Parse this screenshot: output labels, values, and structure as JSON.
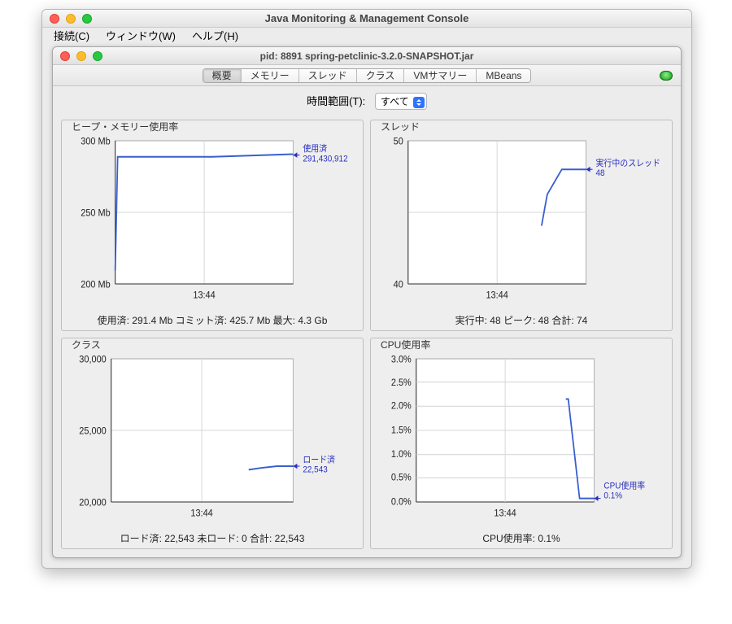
{
  "window": {
    "outer_title": "Java Monitoring & Management Console",
    "inner_title": "pid: 8891 spring-petclinic-3.2.0-SNAPSHOT.jar"
  },
  "menu": {
    "items": [
      "接続(C)",
      "ウィンドウ(W)",
      "ヘルプ(H)"
    ]
  },
  "tabs": {
    "items": [
      "概要",
      "メモリー",
      "スレッド",
      "クラス",
      "VMサマリー",
      "MBeans"
    ],
    "active_index": 0
  },
  "range": {
    "label": "時間範囲(T):",
    "value": "すべて"
  },
  "panels": {
    "heap": {
      "title": "ヒープ・メモリー使用率",
      "footer": "使用済: 291.4 Mb    コミット済: 425.7 Mb    最大: 4.3 Gb",
      "call_label": "使用済",
      "call_value": "291,430,912",
      "yticks": [
        "300 Mb",
        "250 Mb",
        "200 Mb"
      ],
      "xtick": "13:44"
    },
    "threads": {
      "title": "スレッド",
      "footer": "実行中: 48    ピーク: 48    合計: 74",
      "call_label": "実行中のスレッド",
      "call_value": "48",
      "yticks": [
        "50",
        "40"
      ],
      "xtick": "13:44"
    },
    "classes": {
      "title": "クラス",
      "footer": "ロード済: 22,543    未ロード: 0    合計: 22,543",
      "call_label": "ロード済",
      "call_value": "22,543",
      "yticks": [
        "30,000",
        "25,000",
        "20,000"
      ],
      "xtick": "13:44"
    },
    "cpu": {
      "title": "CPU使用率",
      "footer": "CPU使用率: 0.1%",
      "call_label": "CPU使用率",
      "call_value": "0.1%",
      "yticks": [
        "3.0%",
        "2.5%",
        "2.0%",
        "1.5%",
        "1.0%",
        "0.5%",
        "0.0%"
      ],
      "xtick": "13:44"
    }
  },
  "chart_data": [
    {
      "type": "line",
      "title": "ヒープ・メモリー使用率",
      "series": [
        {
          "name": "使用済",
          "values": [
            210,
            290,
            290,
            291.4
          ]
        }
      ],
      "x_tick": "13:44",
      "ylim": [
        200,
        300
      ],
      "yunit": "Mb"
    },
    {
      "type": "line",
      "title": "スレッド",
      "series": [
        {
          "name": "実行中のスレッド",
          "values": [
            44,
            44,
            48,
            48
          ]
        }
      ],
      "x_tick": "13:44",
      "ylim": [
        40,
        50
      ]
    },
    {
      "type": "line",
      "title": "クラス",
      "series": [
        {
          "name": "ロード済",
          "values": [
            22300,
            22400,
            22543,
            22543
          ]
        }
      ],
      "x_tick": "13:44",
      "ylim": [
        20000,
        30000
      ]
    },
    {
      "type": "line",
      "title": "CPU使用率",
      "series": [
        {
          "name": "CPU使用率",
          "values": [
            2.2,
            2.2,
            0.1,
            0.1
          ]
        }
      ],
      "x_tick": "13:44",
      "ylim": [
        0,
        3
      ],
      "yunit": "%"
    }
  ]
}
